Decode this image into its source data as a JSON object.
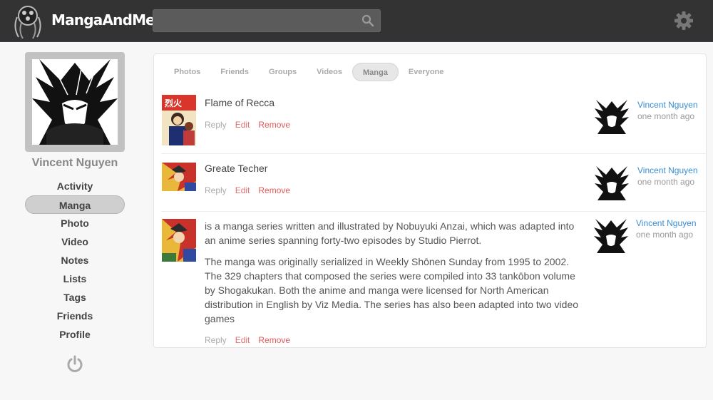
{
  "app": {
    "title": "MangaAndMe"
  },
  "header": {
    "search": {
      "value": "",
      "placeholder": ""
    },
    "icons": {
      "search": "search-icon",
      "settings": "gear-icon"
    }
  },
  "profile": {
    "name": "Vincent Nguyen"
  },
  "nav": {
    "items": [
      {
        "label": "Activity",
        "active": false
      },
      {
        "label": "Manga",
        "active": true
      },
      {
        "label": "Photo",
        "active": false
      },
      {
        "label": "Video",
        "active": false
      },
      {
        "label": "Notes",
        "active": false
      },
      {
        "label": "Lists",
        "active": false
      },
      {
        "label": "Tags",
        "active": false
      },
      {
        "label": "Friends",
        "active": false
      },
      {
        "label": "Profile",
        "active": false
      }
    ]
  },
  "tabs": [
    {
      "label": "Photos",
      "active": false
    },
    {
      "label": "Friends",
      "active": false
    },
    {
      "label": "Groups",
      "active": false
    },
    {
      "label": "Videos",
      "active": false
    },
    {
      "label": "Manga",
      "active": true
    },
    {
      "label": "Everyone",
      "active": false
    }
  ],
  "actions": {
    "reply": "Reply",
    "edit": "Edit",
    "remove": "Remove"
  },
  "posts": [
    {
      "title": "Flame of Recca",
      "author": "Vincent Nguyen",
      "time": "one month ago"
    },
    {
      "title": "Greate Techer",
      "author": "Vincent Nguyen",
      "time": "one month ago"
    },
    {
      "paragraphs": [
        "is a manga series written and illustrated by Nobuyuki Anzai, which was adapted into an anime series spanning forty-two episodes by Studio Pierrot.",
        "The manga was originally serialized in Weekly Shōnen Sunday from 1995 to 2002. The 329 chapters that composed the series were compiled into 33 tankōbon volume by Shogakukan. Both the anime and manga were licensed for North American distribution in English by Viz Media. The series has also been adapted into two video games"
      ],
      "author": "Vincent Nguyen",
      "time": "one month ago"
    }
  ],
  "colors": {
    "topbar": "#333333",
    "link": "#3a8dd1",
    "edit": "#e07070",
    "remove": "#e05a5a"
  }
}
